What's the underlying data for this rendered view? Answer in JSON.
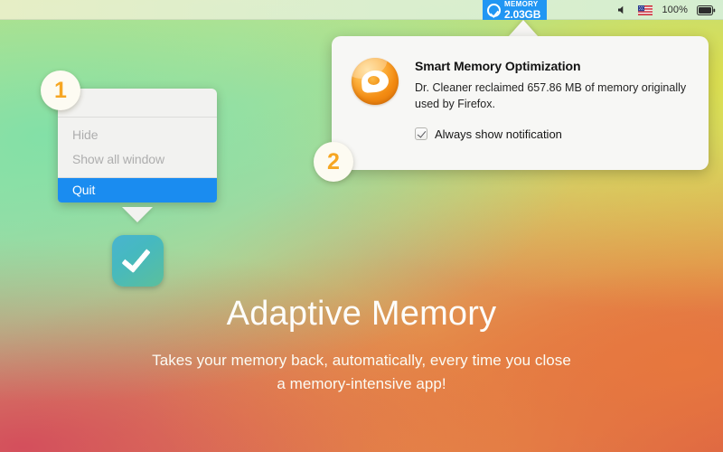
{
  "menubar": {
    "memory_badge": {
      "icon": "circle-check-icon",
      "label": "MEMORY",
      "value": "2.03GB",
      "color": "#2196f3"
    },
    "status_items": [
      {
        "name": "volume-icon",
        "glyph": "speaker"
      },
      {
        "name": "input-language-flag-icon",
        "glyph": "us-flag"
      },
      {
        "name": "battery-percentage",
        "text": "100%"
      },
      {
        "name": "battery-icon",
        "glyph": "battery"
      }
    ]
  },
  "context_menu": {
    "items": [
      {
        "label": "Hide",
        "state": "disabled"
      },
      {
        "label": "Show all window",
        "state": "disabled"
      },
      {
        "label": "Quit",
        "state": "selected"
      }
    ],
    "highlight_color": "#1a8cf0"
  },
  "notification": {
    "icon": "dr-cleaner-app-icon",
    "title": "Smart Memory Optimization",
    "description": "Dr. Cleaner reclaimed 657.86 MB of memory originally used by Firefox.",
    "checkbox": {
      "label": "Always show notification",
      "checked": true
    }
  },
  "dock": {
    "app_icon_name": "dr-cleaner-checkmark-icon"
  },
  "steps": [
    {
      "number": "1"
    },
    {
      "number": "2"
    }
  ],
  "hero": {
    "title": "Adaptive Memory",
    "subtitle": "Takes your memory back, automatically, every time you  close\na memory-intensive app!"
  }
}
